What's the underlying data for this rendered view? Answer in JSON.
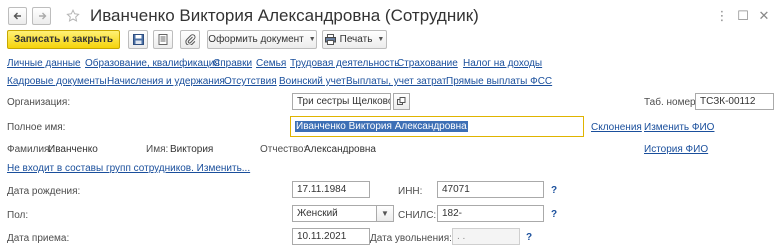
{
  "header": {
    "title": "Иванченко Виктория Александровна (Сотрудник)",
    "back_icon": "arrow-left-icon",
    "forward_icon": "arrow-right-icon",
    "favorite_icon": "star-icon"
  },
  "toolbar": {
    "save_close_label": "Записать и закрыть",
    "document_label": "Оформить документ",
    "print_label": "Печать",
    "accent_color": "#f5d30b"
  },
  "links_row1": [
    "Личные данные",
    "Образование, квалификация",
    "Справки",
    "Семья",
    "Трудовая деятельность",
    "Страхование",
    "Налог на доходы"
  ],
  "links_row2": [
    "Кадровые документы",
    "Начисления и удержания",
    "Отсутствия",
    "Воинский учет",
    "Выплаты, учет затрат",
    "Прямые выплаты ФСС"
  ],
  "form": {
    "organization_label": "Организация:",
    "organization_value": "Три сестры Щелково",
    "tab_number_label": "Таб. номер:",
    "tab_number_value": "ТСЗК-00112",
    "fullname_label": "Полное имя:",
    "fullname_value": "Иванченко Виктория Александровна",
    "declensions_link": "Склонения",
    "change_fio_link": "Изменить ФИО",
    "surname_label": "Фамилия:",
    "surname_value": "Иванченко",
    "name_label": "Имя:",
    "name_value": "Виктория",
    "patronymic_label": "Отчество:",
    "patronymic_value": "Александровна",
    "history_fio_link": "История ФИО",
    "groups_link": "Не входит в составы групп сотрудников. Изменить...",
    "birthdate_label": "Дата рождения:",
    "birthdate_value": "17.11.1984",
    "inn_label": "ИНН:",
    "inn_value": "47071",
    "gender_label": "Пол:",
    "gender_value": "Женский",
    "snils_label": "СНИЛС:",
    "snils_value": "182-",
    "hire_date_label": "Дата приема:",
    "hire_date_value": "10.11.2021",
    "dismissal_label": "Дата увольнения:",
    "dismissal_value": " .  .",
    "help_mark": "?"
  }
}
